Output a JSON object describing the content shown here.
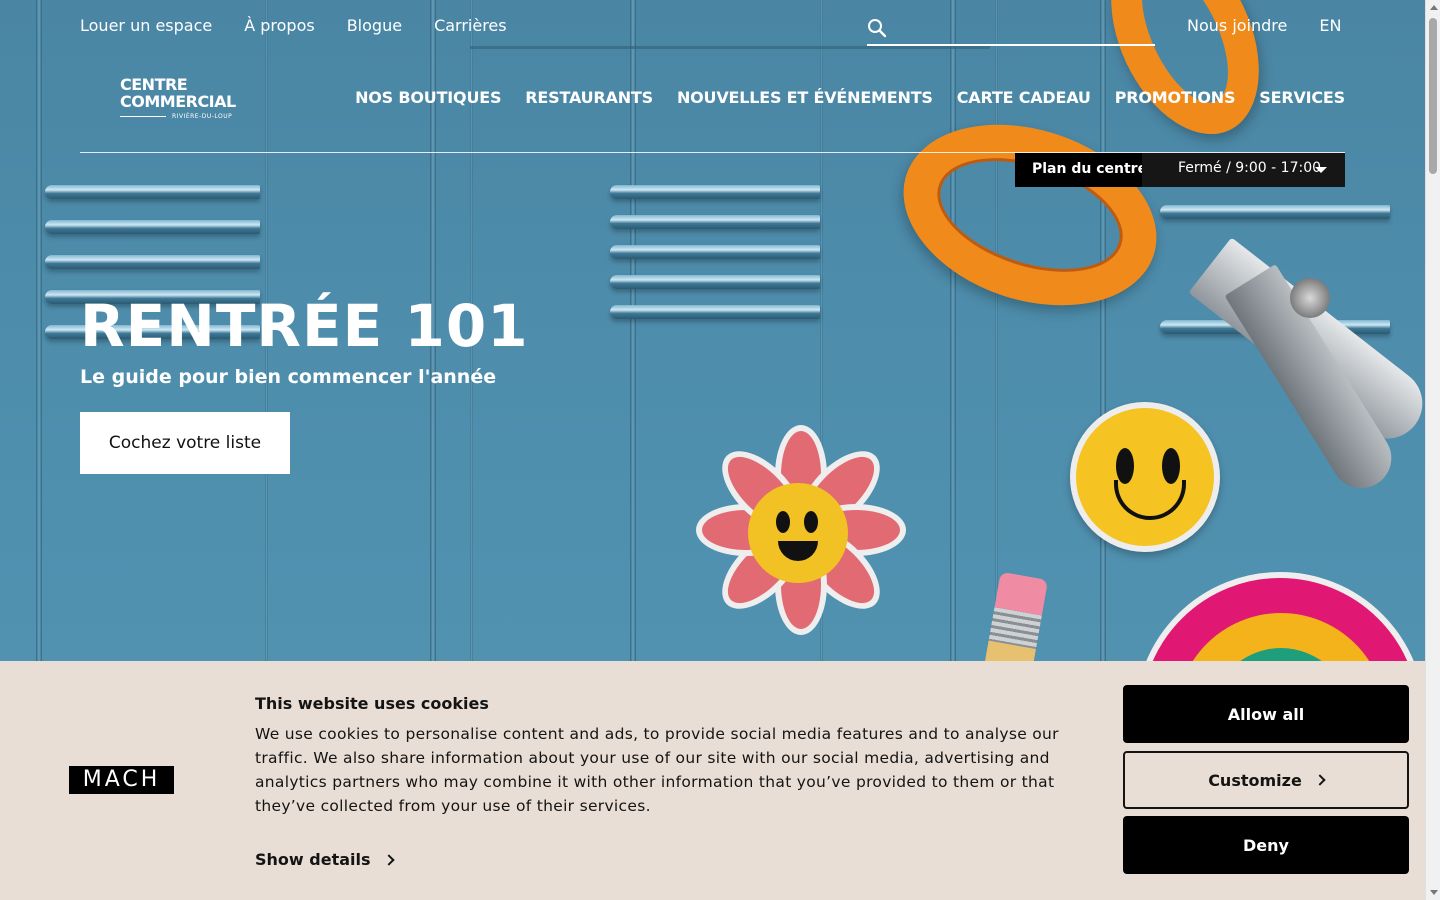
{
  "utility_nav": [
    "Louer un espace",
    "À propos",
    "Blogue",
    "Carrières"
  ],
  "utility_right": [
    "Nous joindre",
    "EN"
  ],
  "search": {
    "placeholder": "",
    "value": ""
  },
  "logo": {
    "line1": "CENTRE",
    "line2": "COMMERCIAL",
    "line3": "RIVIÈRE-DU-LOUP"
  },
  "main_nav": [
    "NOS BOUTIQUES",
    "RESTAURANTS",
    "NOUVELLES ET ÉVÉNEMENTS",
    "CARTE CADEAU",
    "PROMOTIONS",
    "SERVICES"
  ],
  "plan_bar": {
    "plan_label": "Plan du centre",
    "hours": "Fermé / 9:00 - 17:00"
  },
  "hero": {
    "title": "RENTRÉE 101",
    "subtitle": "Le guide pour bien commencer l'année",
    "cta": "Cochez votre liste"
  },
  "cookie_banner": {
    "logo": "MACH",
    "title": "This website uses cookies",
    "text": "We use cookies to personalise content and ads, to provide social media features and to analyse our traffic. We also share information about your use of our site with our social media, advertising and analytics partners who may combine it with other information that you’ve provided to them or that they’ve collected from your use of their services.",
    "show_details": "Show details",
    "allow_all": "Allow all",
    "customize": "Customize",
    "deny": "Deny"
  },
  "colors": {
    "banner_bg": "#e9ded5",
    "hero_bg": "#4f8fae",
    "orange": "#f08a1a"
  },
  "icons": {
    "search": "search-icon",
    "hours_caret": "caret-down-icon",
    "details_chevron": "chevron-right-icon"
  }
}
